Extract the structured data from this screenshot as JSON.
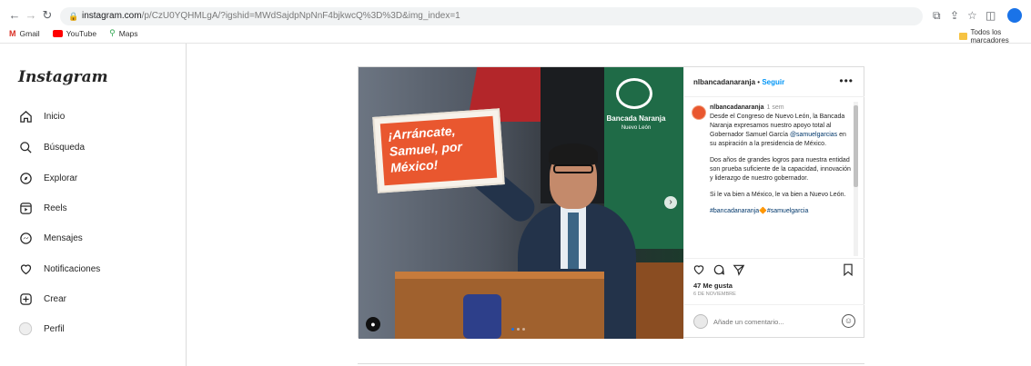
{
  "browser": {
    "url_host": "instagram.com",
    "url_rest": "/p/CzU0YQHMLgA/?igshid=MWdSajdpNpNnF4bjkwcQ%3D%3D&img_index=1",
    "bookmarks": [
      {
        "label": "Gmail",
        "icon": "gmail-icon"
      },
      {
        "label": "YouTube",
        "icon": "youtube-icon"
      },
      {
        "label": "Maps",
        "icon": "maps-icon"
      }
    ],
    "all_bookmarks": "Todos los marcadores"
  },
  "sidebar": {
    "logo": "Instagram",
    "items": [
      {
        "label": "Inicio",
        "icon": "home-icon"
      },
      {
        "label": "Búsqueda",
        "icon": "search-icon"
      },
      {
        "label": "Explorar",
        "icon": "explore-icon"
      },
      {
        "label": "Reels",
        "icon": "reels-icon"
      },
      {
        "label": "Mensajes",
        "icon": "messenger-icon"
      },
      {
        "label": "Notificaciones",
        "icon": "heart-icon"
      },
      {
        "label": "Crear",
        "icon": "plus-square-icon"
      },
      {
        "label": "Perfil",
        "icon": "profile-avatar"
      }
    ]
  },
  "post": {
    "image": {
      "sign_text": "¡Arráncate, Samuel, por México!",
      "brand": "Bancada Naranja",
      "brand_sub": "Nuevo León"
    },
    "header": {
      "username": "nlbancadanaranja",
      "separator": "•",
      "follow": "Seguir"
    },
    "caption": {
      "username": "nlbancadanaranja",
      "time": "1 sem",
      "p1_a": "Desde el Congreso de Nuevo León, la Bancada Naranja expresamos nuestro apoyo total al Gobernador Samuel García ",
      "p1_mention": "@samuelgarcias",
      "p1_b": " en su aspiración a la presidencia de México.",
      "p2": "Dos años de grandes logros para nuestra entidad son prueba suficiente de la capacidad, innovación y liderazgo de nuestro gobernador.",
      "p3": "Si le va bien a México, le va bien a Nuevo León.",
      "hashtags": "#bancadanaranja🔶#samuelgarcia"
    },
    "likes": "47 Me gusta",
    "date": "6 de noviembre",
    "comment_placeholder": "Añade un comentario..."
  },
  "colors": {
    "follow_blue": "#0095f6",
    "sign_orange": "#e9572f",
    "brand_green": "#1f6b47"
  }
}
